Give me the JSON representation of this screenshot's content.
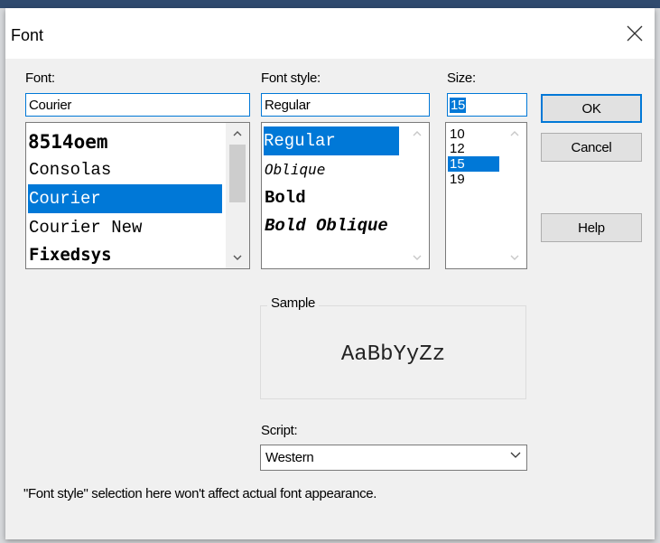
{
  "window": {
    "title": "Font",
    "close_icon": "close-icon"
  },
  "font": {
    "label": "Font:",
    "value": "Courier",
    "items": [
      "8514oem",
      "Consolas",
      "Courier",
      "Courier New",
      "Fixedsys"
    ],
    "selected": "Courier"
  },
  "style": {
    "label": "Font style:",
    "value": "Regular",
    "items": [
      "Regular",
      "Oblique",
      "Bold",
      "Bold Oblique"
    ],
    "selected": "Regular"
  },
  "size": {
    "label": "Size:",
    "value": "15",
    "items": [
      "10",
      "12",
      "15",
      "19"
    ],
    "selected": "15"
  },
  "buttons": {
    "ok": "OK",
    "cancel": "Cancel",
    "help": "Help"
  },
  "sample": {
    "label": "Sample",
    "text": "AaBbYyZz"
  },
  "script": {
    "label": "Script:",
    "value": "Western"
  },
  "note": "\"Font style\" selection here won't affect actual font appearance.",
  "colors": {
    "accent": "#0078d7",
    "title_bar_top": "#2f4a6e"
  }
}
